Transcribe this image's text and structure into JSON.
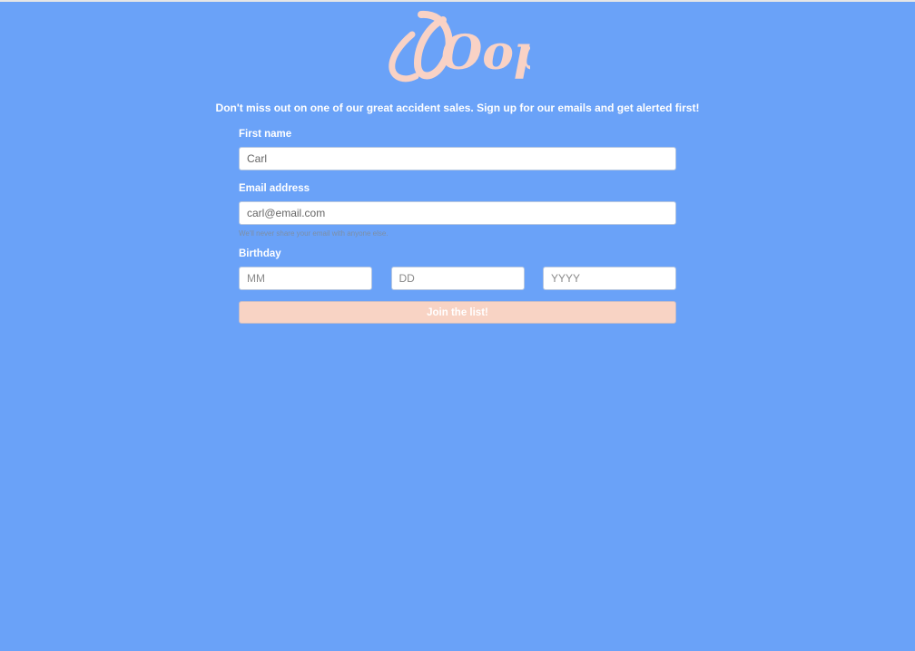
{
  "logo": {
    "text": "Oops",
    "color": "#f9d2c5"
  },
  "tagline": "Don't miss out on one of our great accident sales. Sign up for our emails and get alerted first!",
  "form": {
    "first_name": {
      "label": "First name",
      "value": "Carl"
    },
    "email": {
      "label": "Email address",
      "value": "carl@email.com",
      "help": "We'll never share your email with anyone else."
    },
    "birthday": {
      "label": "Birthday",
      "month_placeholder": "MM",
      "day_placeholder": "DD",
      "year_placeholder": "YYYY"
    },
    "submit_label": "Join the list!"
  },
  "colors": {
    "background": "#6aa2f8",
    "accent": "#f8d3c4",
    "text": "#ffffff"
  }
}
